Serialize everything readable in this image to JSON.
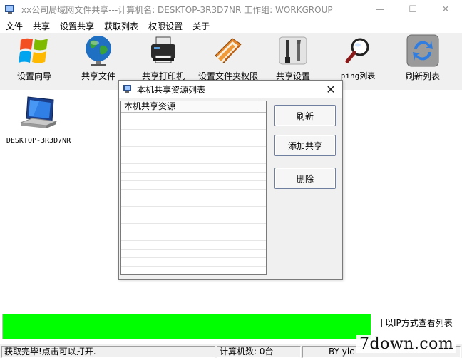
{
  "window": {
    "title": "xx公司局域网文件共享---计算机名: DESKTOP-3R3D7NR  工作组: WORKGROUP",
    "minimize_glyph": "—",
    "maximize_glyph": "☐",
    "close_glyph": "✕"
  },
  "menu": [
    "文件",
    "共享",
    "设置共享",
    "获取列表",
    "权限设置",
    "关于"
  ],
  "toolbar": [
    {
      "label": "设置向导",
      "icon": "windows-logo-icon"
    },
    {
      "label": "共享文件",
      "icon": "globe-icon"
    },
    {
      "label": "共享打印机",
      "icon": "printer-icon"
    },
    {
      "label": "设置文件夹权限",
      "icon": "folder-book-icon"
    },
    {
      "label": "共享设置",
      "icon": "tools-icon"
    },
    {
      "label": "ping列表",
      "icon": "magnifier-icon"
    },
    {
      "label": "刷新列表",
      "icon": "refresh-icon"
    }
  ],
  "computers": [
    {
      "name": "DESKTOP-3R3D7NR"
    }
  ],
  "dialog": {
    "title": "本机共享资源列表",
    "close_glyph": "✕",
    "list_header": "本机共享资源",
    "buttons": {
      "refresh": "刷新",
      "add": "添加共享",
      "delete": "删除"
    }
  },
  "progress": {
    "value": 1.0,
    "color": "#00ff00"
  },
  "ip_checkbox": {
    "label": "以IP方式查看列表",
    "checked": false
  },
  "status": {
    "message": "获取完毕!点击可以打开.",
    "count": "计算机数: 0台",
    "author": "BY ylc"
  },
  "watermark": "7down.com"
}
